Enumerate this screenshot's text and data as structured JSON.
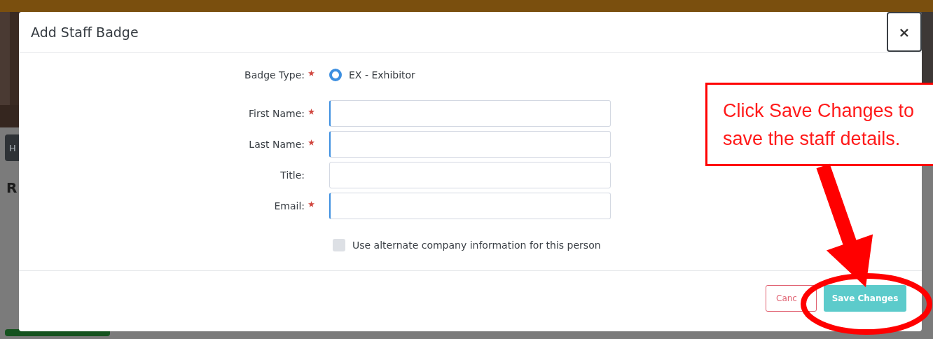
{
  "background": {
    "button": "H",
    "heading": "R"
  },
  "modal": {
    "title": "Add Staff Badge",
    "close": "×",
    "fields": [
      {
        "kind": "radio",
        "label": "Badge Type:",
        "required": true,
        "option": "EX - Exhibitor",
        "selected": true
      },
      {
        "kind": "text",
        "label": "First Name:",
        "required": true
      },
      {
        "kind": "text",
        "label": "Last Name:",
        "required": true
      },
      {
        "kind": "text",
        "label": "Title:",
        "required": false
      },
      {
        "kind": "text",
        "label": "Email:",
        "required": true
      }
    ],
    "checkbox": {
      "label": "Use alternate company information for this person",
      "checked": false
    },
    "buttons": [
      {
        "kind": "cancel",
        "label": "Canc"
      },
      {
        "kind": "primary",
        "label": "Save Changes"
      }
    ]
  },
  "annotation": {
    "text": "Click Save Changes to save the staff details."
  }
}
